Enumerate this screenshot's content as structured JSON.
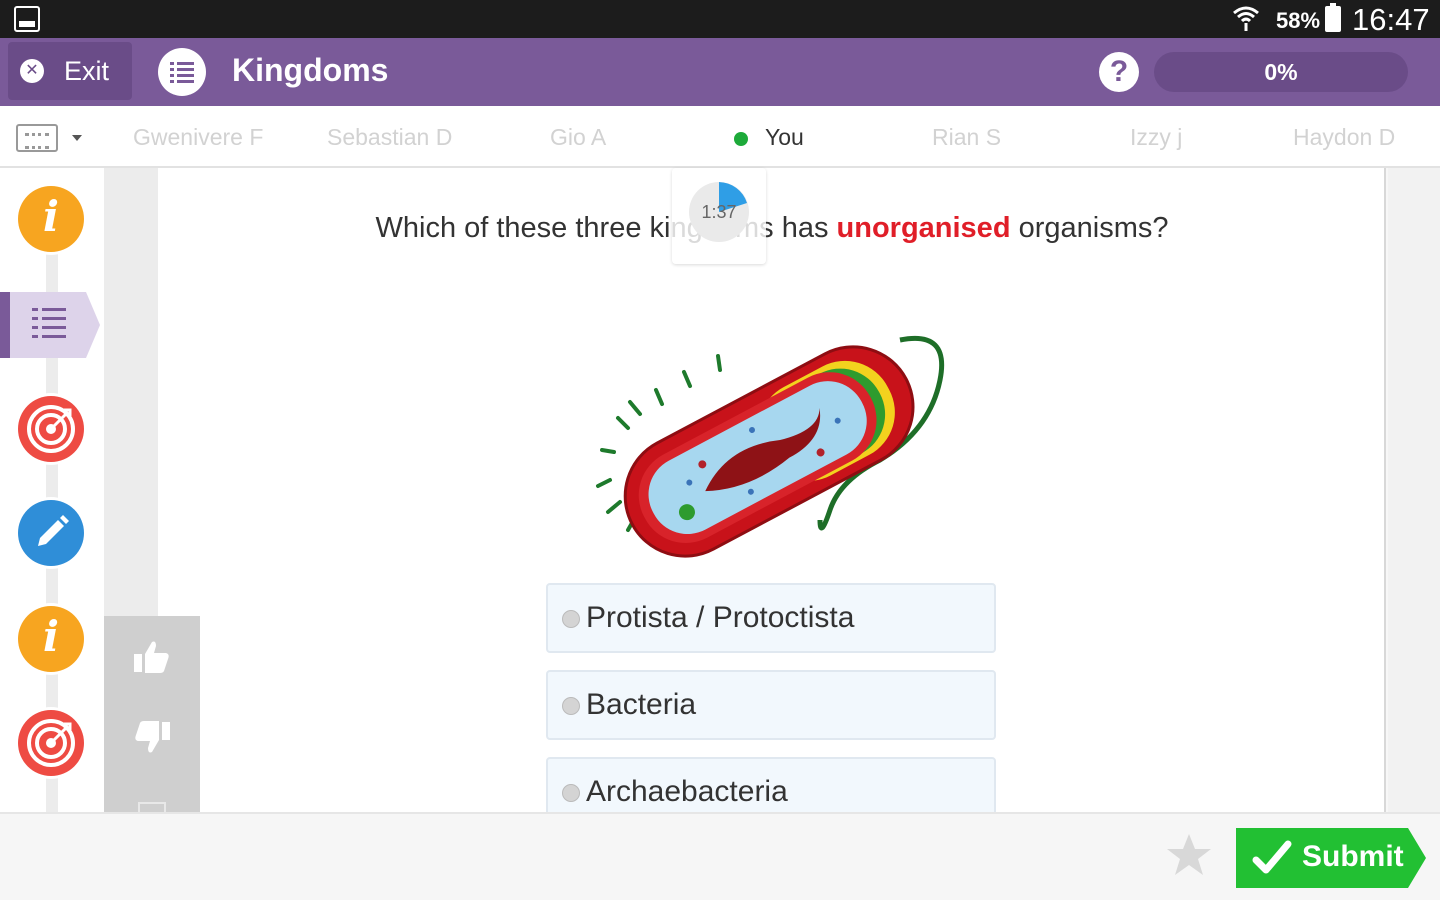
{
  "status_bar": {
    "battery": "58%",
    "time": "16:47"
  },
  "header": {
    "exit_label": "Exit",
    "title": "Kingdoms",
    "progress_label": "0%",
    "progress_value": 0
  },
  "players": [
    {
      "name": "Gwenivere F",
      "active": false
    },
    {
      "name": "Sebastian D",
      "active": false
    },
    {
      "name": "Gio A",
      "active": false
    },
    {
      "name": "You",
      "active": true
    },
    {
      "name": "Rian S",
      "active": false
    },
    {
      "name": "Izzy j",
      "active": false
    },
    {
      "name": "Haydon D",
      "active": false
    }
  ],
  "timer": {
    "text": "1:37"
  },
  "question": {
    "before": "Which of these three kingdoms has ",
    "highlight": "unorganised",
    "after": " organisms?"
  },
  "options": [
    {
      "label": "Protista / Protoctista"
    },
    {
      "label": "Bacteria"
    },
    {
      "label": "Archaebacteria"
    }
  ],
  "footer": {
    "submit_label": "Submit"
  },
  "colors": {
    "brand_purple": "#7a5a99",
    "highlight_red": "#e01e28",
    "submit_green": "#22c033",
    "info_orange": "#f7a520",
    "target_red": "#ee4b43",
    "pencil_blue": "#2f8ed8"
  }
}
